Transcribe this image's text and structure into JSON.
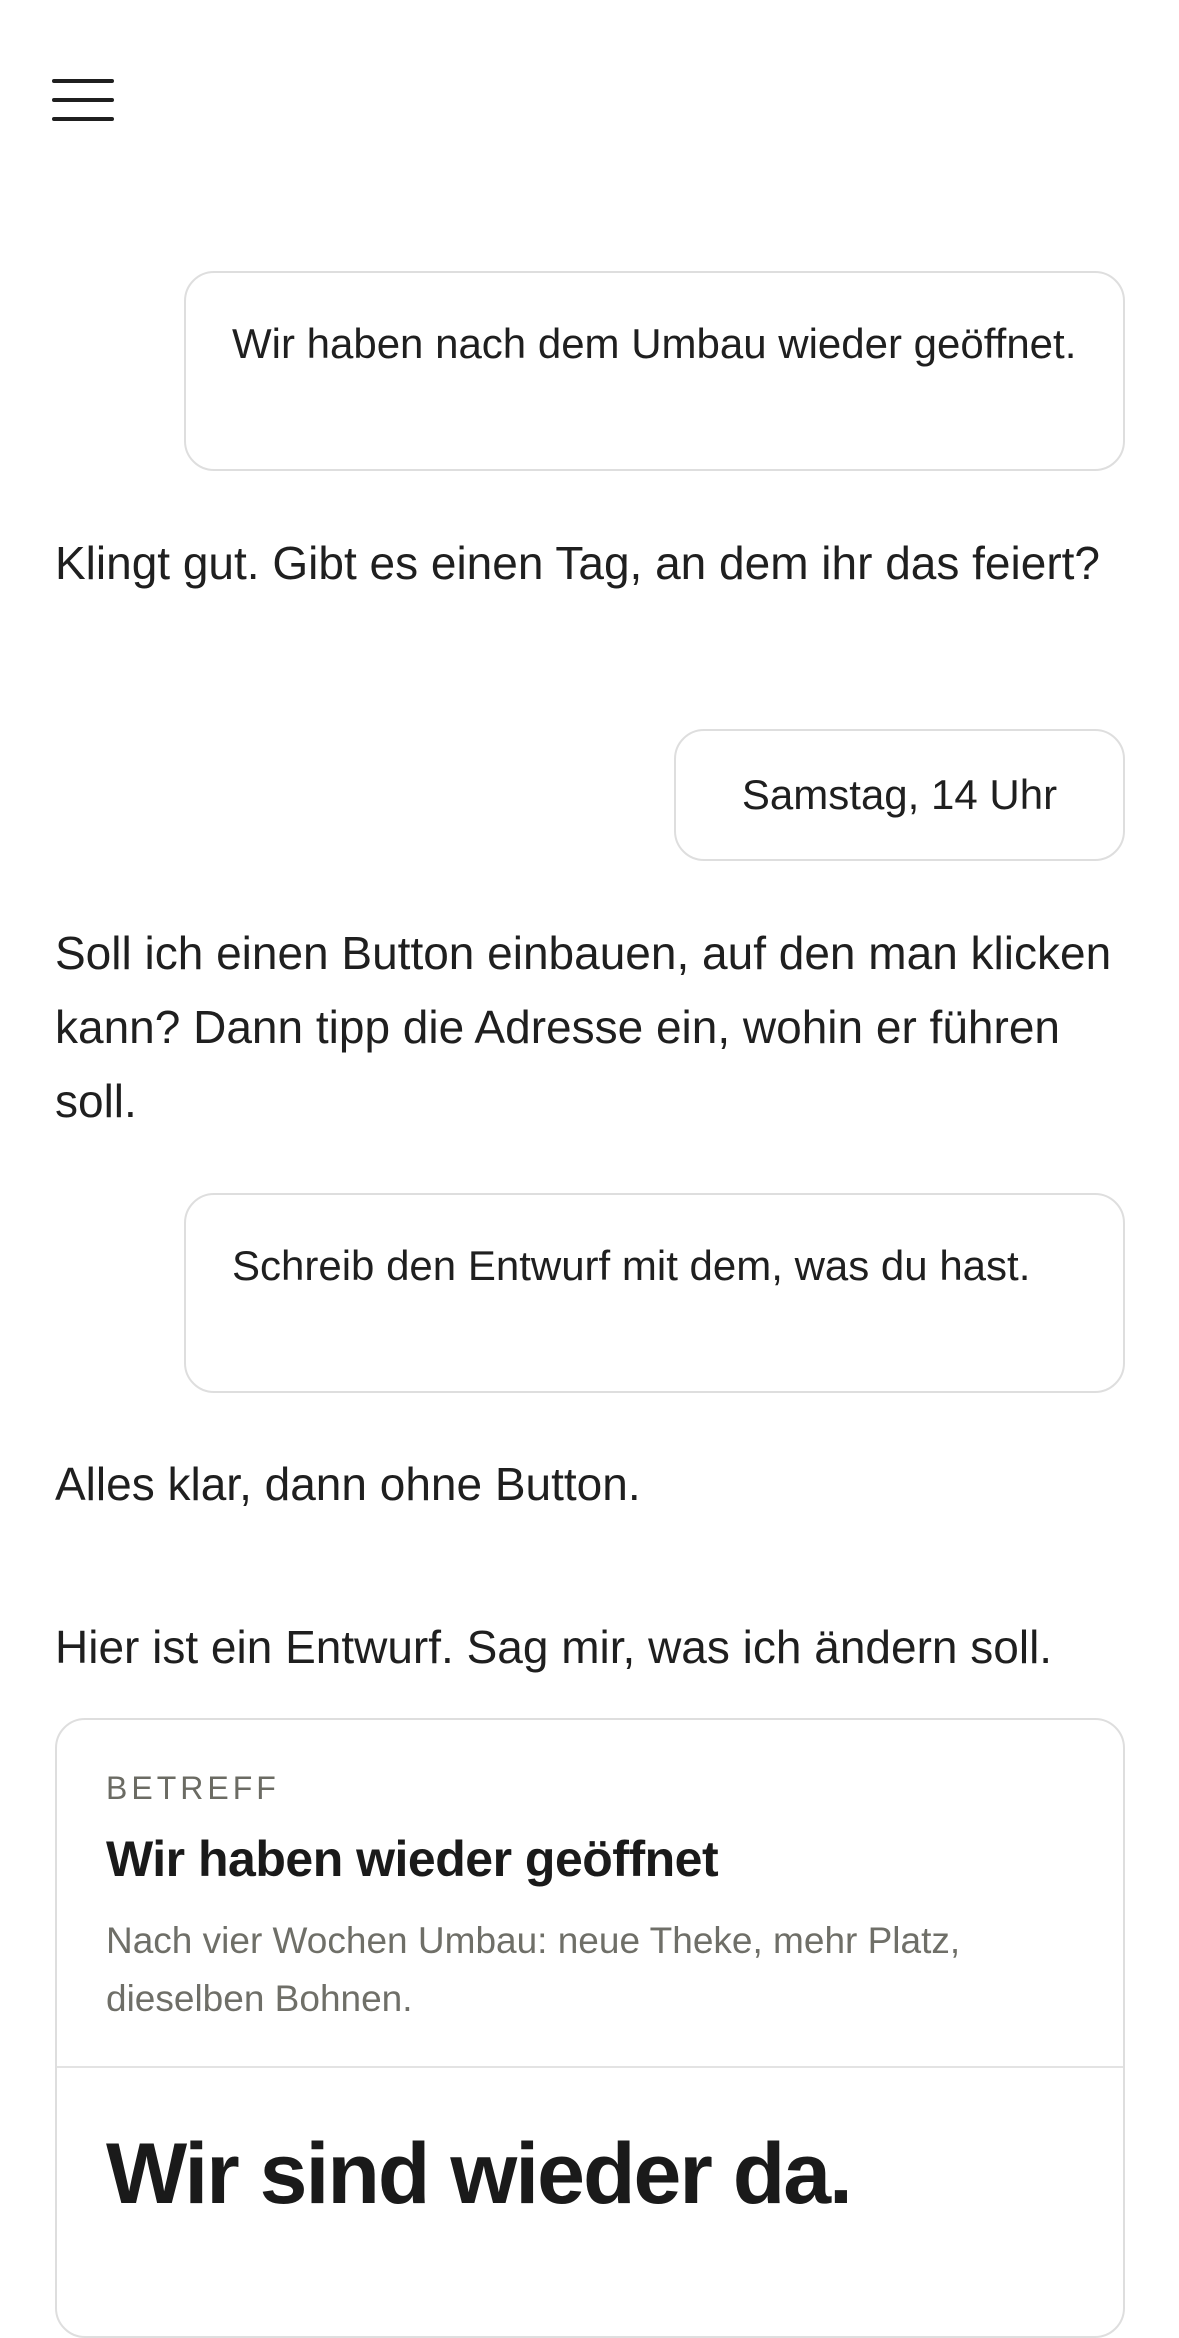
{
  "header": {
    "menu_icon": "hamburger-menu-icon"
  },
  "conversation": {
    "user_message_1": "Wir haben nach dem Umbau wieder geöffnet.",
    "assistant_message_1": "Klingt gut. Gibt es einen Tag, an dem ihr das feiert?",
    "user_message_2": "Samstag, 14 Uhr",
    "assistant_message_2": "Soll ich einen Button einbauen, auf den man klicken kann? Dann tipp die Adresse ein, wohin er führen soll.",
    "user_message_3": "Schreib den Entwurf mit dem, was du hast.",
    "assistant_message_3": "Alles klar, dann ohne Button.",
    "assistant_message_4": "Hier ist ein Entwurf. Sag mir, was ich ändern soll."
  },
  "email_draft": {
    "subject_label": "BETREFF",
    "subject": "Wir haben wieder geöffnet",
    "preview": "Nach vier Wochen Umbau: neue Theke, mehr Platz, dieselben Bohnen.",
    "headline": "Wir sind wieder da."
  }
}
